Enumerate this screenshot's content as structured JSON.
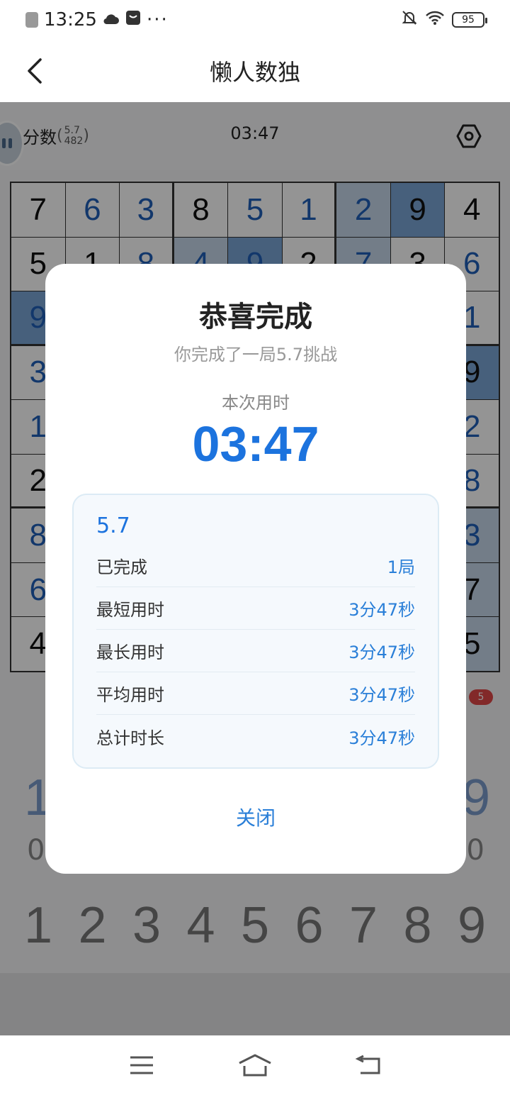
{
  "status_bar": {
    "time": "13:25",
    "dots": "···",
    "battery": "95"
  },
  "header": {
    "title": "懒人数独"
  },
  "game": {
    "score_label": "分数",
    "score_difficulty": "5.7",
    "score_points": "482",
    "timer": "03:47",
    "tools_badge": "5",
    "big_left": "1",
    "big_right": "9",
    "zero_left": "0",
    "zero_right": "0",
    "numpad": [
      "1",
      "2",
      "3",
      "4",
      "5",
      "6",
      "7",
      "8",
      "9"
    ],
    "grid": [
      [
        {
          "v": "7",
          "t": "given"
        },
        {
          "v": "6",
          "t": "user"
        },
        {
          "v": "3",
          "t": "user"
        },
        {
          "v": "8",
          "t": "given"
        },
        {
          "v": "5",
          "t": "user"
        },
        {
          "v": "1",
          "t": "user"
        },
        {
          "v": "2",
          "t": "user",
          "h": "hl"
        },
        {
          "v": "9",
          "t": "given",
          "h": "sel"
        },
        {
          "v": "4",
          "t": "given"
        }
      ],
      [
        {
          "v": "5",
          "t": "given"
        },
        {
          "v": "1",
          "t": "given"
        },
        {
          "v": "8",
          "t": "user"
        },
        {
          "v": "4",
          "t": "user",
          "h": "hl"
        },
        {
          "v": "9",
          "t": "user",
          "h": "sel"
        },
        {
          "v": "2",
          "t": "given"
        },
        {
          "v": "7",
          "t": "user",
          "h": "hl"
        },
        {
          "v": "3",
          "t": "given"
        },
        {
          "v": "6",
          "t": "user"
        }
      ],
      [
        {
          "v": "9",
          "t": "user",
          "h": "sel"
        },
        {
          "v": "",
          "t": "user"
        },
        {
          "v": "",
          "t": "user"
        },
        {
          "v": "",
          "t": "user"
        },
        {
          "v": "",
          "t": "user"
        },
        {
          "v": "",
          "t": "user"
        },
        {
          "v": "",
          "t": "user"
        },
        {
          "v": "",
          "t": "user"
        },
        {
          "v": "1",
          "t": "user"
        }
      ],
      [
        {
          "v": "3",
          "t": "user"
        },
        {
          "v": "",
          "t": "user"
        },
        {
          "v": "",
          "t": "user"
        },
        {
          "v": "",
          "t": "user"
        },
        {
          "v": "",
          "t": "user"
        },
        {
          "v": "",
          "t": "user"
        },
        {
          "v": "",
          "t": "user"
        },
        {
          "v": "",
          "t": "user"
        },
        {
          "v": "9",
          "t": "given",
          "h": "sel"
        }
      ],
      [
        {
          "v": "1",
          "t": "user"
        },
        {
          "v": "",
          "t": "user"
        },
        {
          "v": "",
          "t": "user"
        },
        {
          "v": "",
          "t": "user"
        },
        {
          "v": "",
          "t": "user"
        },
        {
          "v": "",
          "t": "user"
        },
        {
          "v": "",
          "t": "user"
        },
        {
          "v": "",
          "t": "user"
        },
        {
          "v": "2",
          "t": "user"
        }
      ],
      [
        {
          "v": "2",
          "t": "given"
        },
        {
          "v": "",
          "t": "user"
        },
        {
          "v": "",
          "t": "user"
        },
        {
          "v": "",
          "t": "user"
        },
        {
          "v": "",
          "t": "user"
        },
        {
          "v": "",
          "t": "user"
        },
        {
          "v": "",
          "t": "user"
        },
        {
          "v": "",
          "t": "user"
        },
        {
          "v": "8",
          "t": "user"
        }
      ],
      [
        {
          "v": "8",
          "t": "user"
        },
        {
          "v": "",
          "t": "user"
        },
        {
          "v": "",
          "t": "user"
        },
        {
          "v": "",
          "t": "user"
        },
        {
          "v": "",
          "t": "user"
        },
        {
          "v": "",
          "t": "user"
        },
        {
          "v": "",
          "t": "user"
        },
        {
          "v": "",
          "t": "user"
        },
        {
          "v": "3",
          "t": "user",
          "h": "hl"
        }
      ],
      [
        {
          "v": "6",
          "t": "user"
        },
        {
          "v": "",
          "t": "user"
        },
        {
          "v": "",
          "t": "user"
        },
        {
          "v": "",
          "t": "user"
        },
        {
          "v": "",
          "t": "user"
        },
        {
          "v": "",
          "t": "user"
        },
        {
          "v": "",
          "t": "user"
        },
        {
          "v": "",
          "t": "user"
        },
        {
          "v": "7",
          "t": "given",
          "h": "hl"
        }
      ],
      [
        {
          "v": "4",
          "t": "given"
        },
        {
          "v": "",
          "t": "user"
        },
        {
          "v": "",
          "t": "user"
        },
        {
          "v": "",
          "t": "user"
        },
        {
          "v": "",
          "t": "user"
        },
        {
          "v": "",
          "t": "user"
        },
        {
          "v": "",
          "t": "user"
        },
        {
          "v": "",
          "t": "user"
        },
        {
          "v": "5",
          "t": "given",
          "h": "hl"
        }
      ]
    ]
  },
  "dialog": {
    "title": "恭喜完成",
    "subtitle": "你完成了一局5.7挑战",
    "time_label": "本次用时",
    "time_value": "03:47",
    "level": "5.7",
    "stats": [
      {
        "key": "已完成",
        "value": "1局"
      },
      {
        "key": "最短用时",
        "value": "3分47秒"
      },
      {
        "key": "最长用时",
        "value": "3分47秒"
      },
      {
        "key": "平均用时",
        "value": "3分47秒"
      },
      {
        "key": "总计时长",
        "value": "3分47秒"
      }
    ],
    "close_label": "关闭"
  },
  "colors": {
    "accent": "#1c73de",
    "link": "#2a7fd8",
    "cell_highlight": "#c7d7ea",
    "cell_selected": "#7aa6d6",
    "badge": "#e04848"
  }
}
